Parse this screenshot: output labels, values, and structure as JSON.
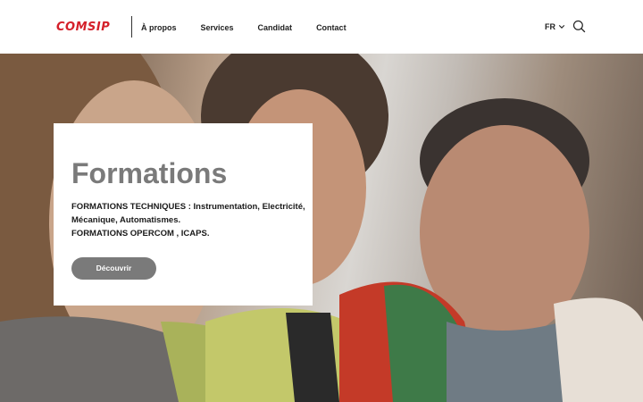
{
  "header": {
    "logo_text": "COMSIP",
    "nav": [
      "À propos",
      "Services",
      "Candidat",
      "Contact"
    ],
    "language": "FR"
  },
  "hero": {
    "title": "Formations",
    "description_lines": [
      "FORMATIONS TECHNIQUES : Instrumentation, Electricité,",
      "Mécanique, Automatismes.",
      "FORMATIONS OPERCOM , ICAPS."
    ],
    "button_label": "Découvrir"
  },
  "colors": {
    "brand": "#d4202a",
    "button": "#7a7a7a",
    "title": "#7a7a7a"
  },
  "icons": [
    "chevron-down-icon",
    "search-icon"
  ]
}
